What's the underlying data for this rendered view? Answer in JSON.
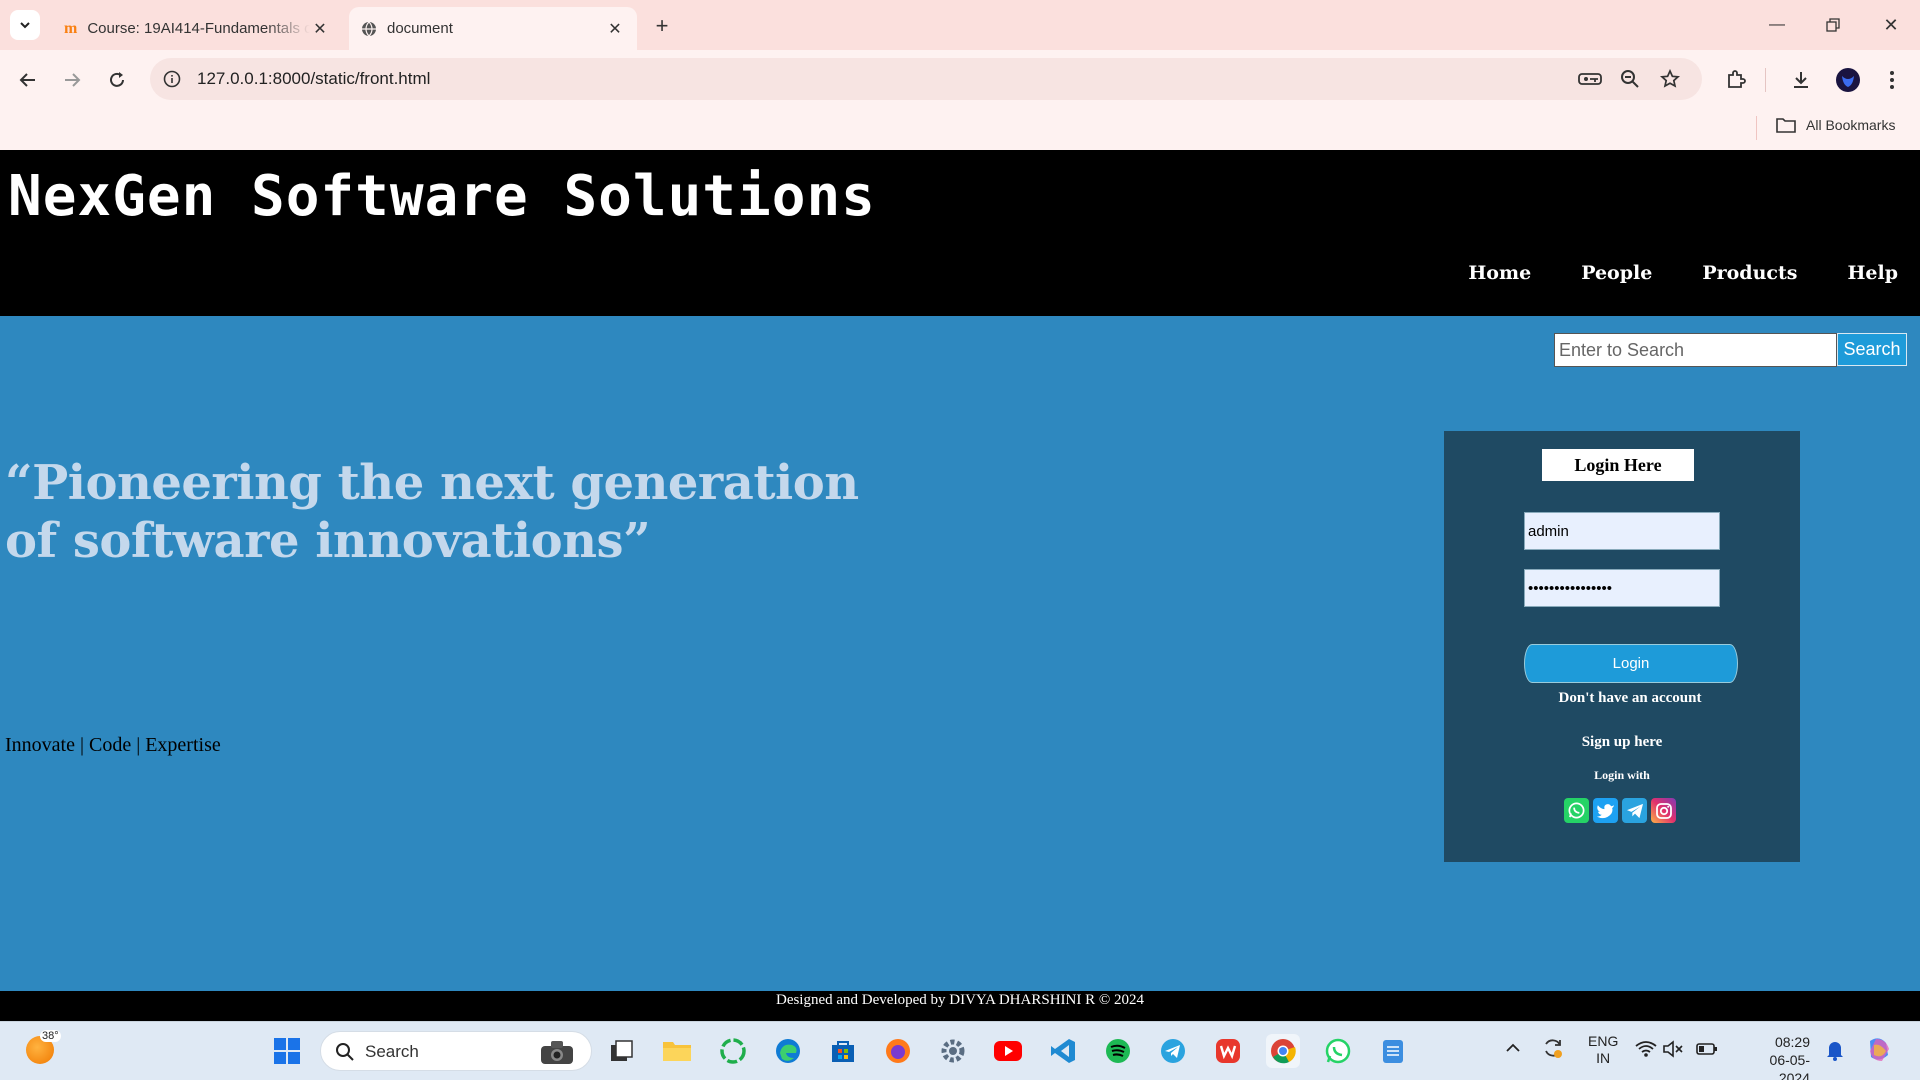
{
  "browser": {
    "tabs": [
      {
        "title": "Course: 19AI414-Fundamentals of Web Application",
        "icon": "moodle-icon",
        "active": false
      },
      {
        "title": "document",
        "icon": "globe-icon",
        "active": true
      }
    ],
    "url": "127.0.0.1:8000/static/front.html",
    "bookmarks_label": "All Bookmarks"
  },
  "page": {
    "site_title": "NexGen Software Solutions",
    "nav": [
      "Home",
      "People",
      "Products",
      "Help"
    ],
    "search": {
      "placeholder": "Enter to Search",
      "button": "Search"
    },
    "tagline": "“Pioneering the next generation of software innovations”",
    "motto": "Innovate | Code | Expertise",
    "login": {
      "title": "Login Here",
      "username": "admin",
      "password": "••••••••••••••••",
      "button": "Login",
      "no_account": "Don't have an account",
      "signup": "Sign up here",
      "login_with": "Login with",
      "socials": [
        "whatsapp-icon",
        "twitter-icon",
        "telegram-icon",
        "instagram-icon"
      ]
    },
    "footer": "Designed and Developed by DIVYA DHARSHINI R © 2024",
    "colors": {
      "header": "#000000",
      "main_bg": "#2e88bf",
      "panel_bg": "#1f4a63",
      "tagline": "#c4d8ec",
      "button": "#1e9bd9"
    }
  },
  "taskbar": {
    "weather_temp": "38°",
    "search_label": "Search",
    "apps": [
      "windows-start-icon",
      "camera-icon",
      "file-explorer-icon",
      "folder-icon",
      "app-icon",
      "edge-icon",
      "microsoft-store-icon",
      "firefox-icon",
      "settings-icon",
      "youtube-icon",
      "vscode-icon",
      "spotify-icon",
      "telegram-icon",
      "wps-office-icon",
      "chrome-icon",
      "whatsapp-icon",
      "notepad-icon"
    ],
    "lang_top": "ENG",
    "lang_bottom": "IN",
    "time": "08:29",
    "date": "06-05-2024"
  }
}
